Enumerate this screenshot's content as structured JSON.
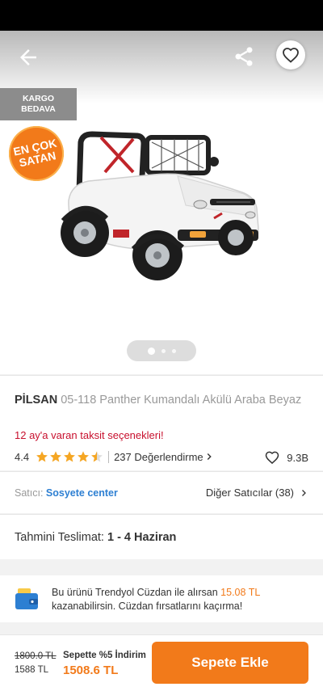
{
  "header": {
    "back_icon": "back-arrow-icon",
    "share_icon": "share-icon",
    "favorite_icon": "heart-outline-icon"
  },
  "badges": {
    "kargo_line1": "KARGO",
    "kargo_line2": "BEDAVA",
    "best_line1": "EN ÇOK",
    "best_line2": "SATAN"
  },
  "gallery": {
    "image_count": 3,
    "active_index": 0
  },
  "product": {
    "brand": "PİLSAN",
    "name": "05-118 Panther Kumandalı Akülü Araba Beyaz",
    "installment": "12 ay'a varan taksit seçenekleri!",
    "rating": "4.4",
    "rating_value": 4.4,
    "reviews": "237 Değerlendirme",
    "favorites": "9.3B"
  },
  "seller": {
    "label": "Satıcı:",
    "name": "Sosyete center",
    "others": "Diğer Satıcılar (38)"
  },
  "delivery": {
    "label": "Tahmini Teslimat:",
    "value": "1 - 4 Haziran"
  },
  "wallet": {
    "text_before": "Bu ürünü Trendyol Cüzdan ile alırsan",
    "amount": "15.08 TL",
    "text_after": "kazanabilirsin. Cüzdan fırsatlarını kaçırma!"
  },
  "pricing": {
    "old_price": "1800.0 TL",
    "base_price": "1588 TL",
    "promo_label": "Sepette %5 İndirim",
    "promo_price": "1508.6 TL",
    "add_to_cart": "Sepete Ekle"
  },
  "colors": {
    "brand_orange": "#f27a1a",
    "link_blue": "#2d7fd2",
    "installment_red": "#c8102e",
    "star_yellow": "#f5a623"
  }
}
